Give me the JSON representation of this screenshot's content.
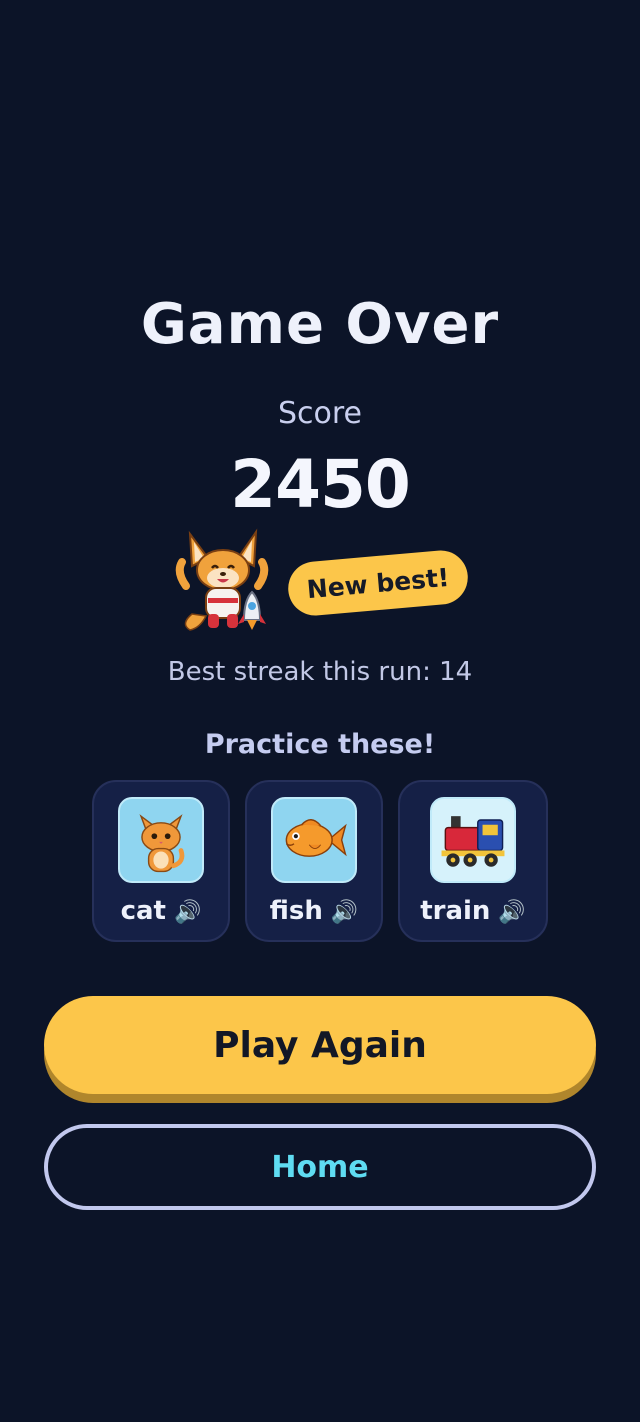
{
  "screen": {
    "title": "Game Over",
    "score_label": "Score",
    "score_value": "2450",
    "badge": "New best!",
    "streak_text": "Best streak this run: 14",
    "practice_title": "Practice these!"
  },
  "practice_items": [
    {
      "word": "cat",
      "picture": "cat-picture",
      "icon": "speaker-icon",
      "speaker": "🔊"
    },
    {
      "word": "fish",
      "picture": "fish-picture",
      "icon": "speaker-icon",
      "speaker": "🔊"
    },
    {
      "word": "train",
      "picture": "train-picture",
      "icon": "speaker-icon",
      "speaker": "🔊"
    }
  ],
  "buttons": {
    "play_again": "Play Again",
    "home": "Home"
  },
  "colors": {
    "background": "#0c1428",
    "accent_yellow": "#fcc64a",
    "home_text": "#5fdcf2",
    "card_bg": "#152046"
  }
}
